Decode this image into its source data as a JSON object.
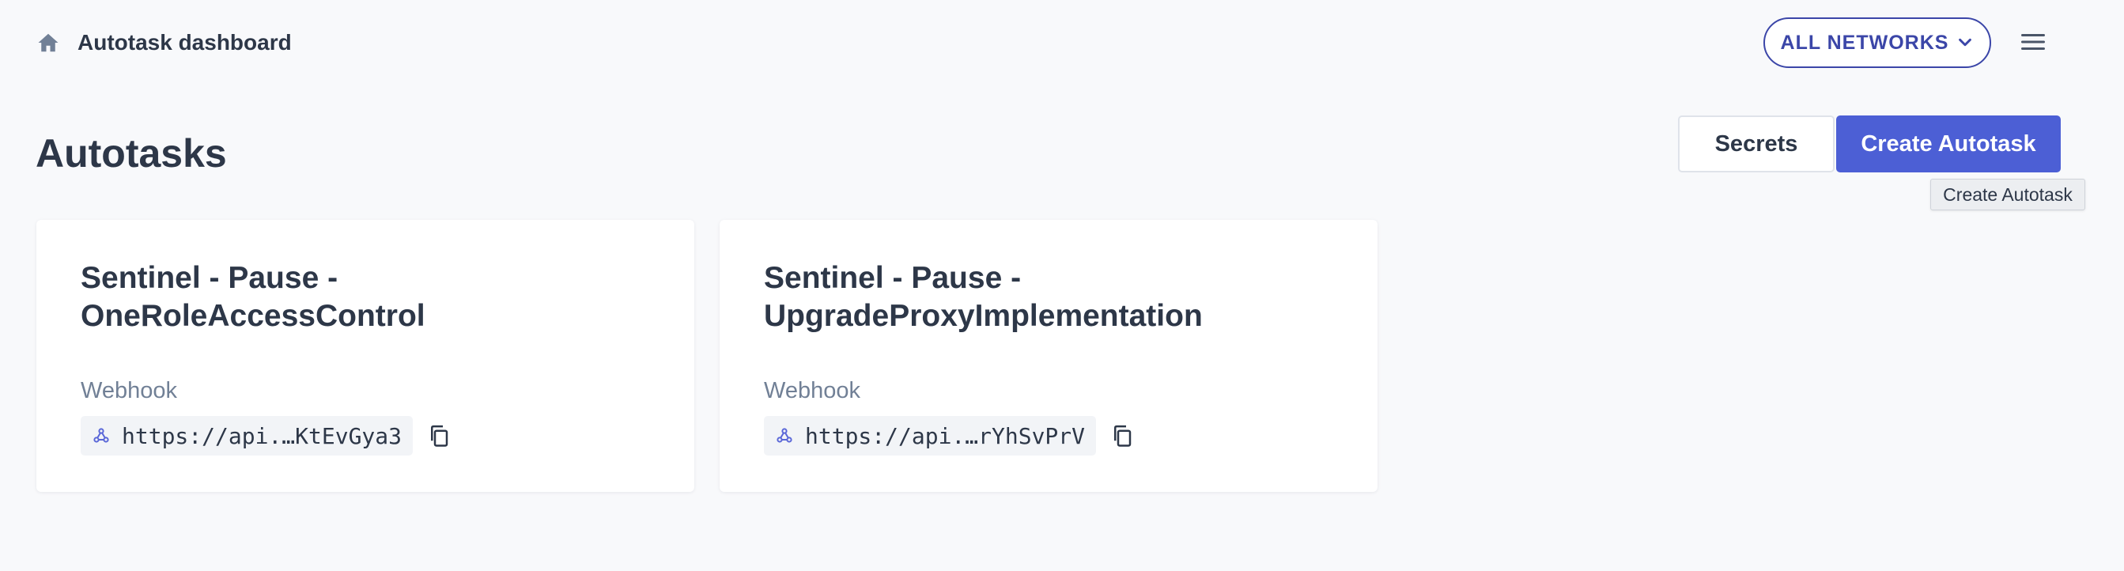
{
  "header": {
    "breadcrumb": "Autotask dashboard",
    "home_icon": "home-icon",
    "network_selector": "ALL NETWORKS",
    "menu_icon": "hamburger-menu-icon"
  },
  "main": {
    "title": "Autotasks",
    "secrets_button": "Secrets",
    "create_button": "Create Autotask",
    "tooltip": "Create Autotask"
  },
  "autotasks": [
    {
      "name": "Sentinel - Pause - OneRoleAccessControl",
      "trigger_label": "Webhook",
      "webhook_url": "https://api.…KtEvGya3"
    },
    {
      "name": "Sentinel - Pause - UpgradeProxyImplementation",
      "trigger_label": "Webhook",
      "webhook_url": "https://api.…rYhSvPrV"
    }
  ],
  "colors": {
    "accent": "#4c5fd5",
    "network_border": "#3b46a8",
    "text": "#2d3748",
    "muted": "#718096",
    "background": "#f8f9fb"
  }
}
